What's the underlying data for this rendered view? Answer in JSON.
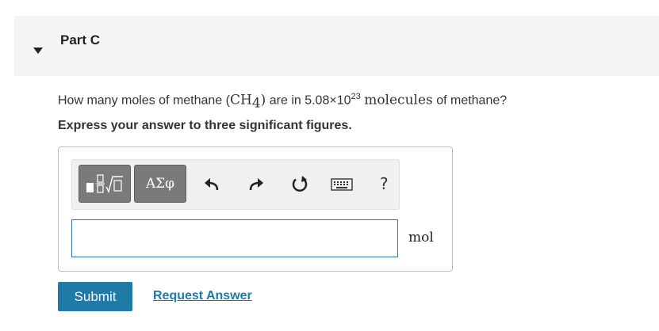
{
  "part": {
    "title": "Part C"
  },
  "question": {
    "prefix": "How many moles of methane (",
    "formula_main": "CH",
    "formula_sub": "4",
    "formula_close": ")",
    "middle": " are in 5.08×10",
    "exponent": "23",
    "space": " ",
    "serif_word": "molecules",
    "suffix": " of methane?"
  },
  "instruction": "Express your answer to three significant figures.",
  "toolbar": {
    "template_icon": "templates-icon",
    "greek_label": "ΑΣφ",
    "undo_icon": "undo-icon",
    "redo_icon": "redo-icon",
    "reset_icon": "reset-icon",
    "keyboard_icon": "keyboard-icon",
    "help_label": "?"
  },
  "answer": {
    "value": "",
    "unit": "mol"
  },
  "actions": {
    "submit_label": "Submit",
    "request_label": "Request Answer"
  },
  "colors": {
    "accent": "#1f7aa6",
    "header_bg": "#f5f5f5",
    "toolbar_button": "#7a7a7a"
  }
}
